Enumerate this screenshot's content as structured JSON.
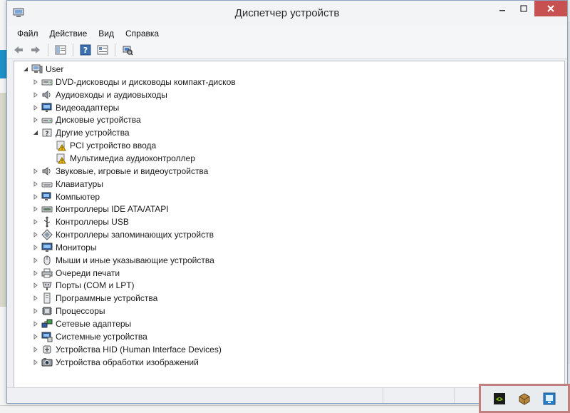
{
  "window": {
    "title": "Диспетчер устройств"
  },
  "menu": [
    "Файл",
    "Действие",
    "Вид",
    "Справка"
  ],
  "tree": {
    "root": "User",
    "items": [
      {
        "label": "DVD-дисководы и дисководы компакт-дисков",
        "icon": "dvd-drive-icon",
        "expanded": false,
        "level": 1
      },
      {
        "label": "Аудиовходы и аудиовыходы",
        "icon": "speaker-icon",
        "expanded": false,
        "level": 1
      },
      {
        "label": "Видеоадаптеры",
        "icon": "display-adapter-icon",
        "expanded": false,
        "level": 1
      },
      {
        "label": "Дисковые устройства",
        "icon": "disk-drive-icon",
        "expanded": false,
        "level": 1
      },
      {
        "label": "Другие устройства",
        "icon": "unknown-device-icon",
        "expanded": true,
        "level": 1
      },
      {
        "label": "PCI устройство ввода",
        "icon": "warning-device-icon",
        "level": 2
      },
      {
        "label": "Мультимедиа аудиоконтроллер",
        "icon": "warning-device-icon",
        "level": 2
      },
      {
        "label": "Звуковые, игровые и видеоустройства",
        "icon": "speaker-icon",
        "expanded": false,
        "level": 1
      },
      {
        "label": "Клавиатуры",
        "icon": "keyboard-icon",
        "expanded": false,
        "level": 1
      },
      {
        "label": "Компьютер",
        "icon": "computer-icon",
        "expanded": false,
        "level": 1
      },
      {
        "label": "Контроллеры IDE ATA/ATAPI",
        "icon": "ide-controller-icon",
        "expanded": false,
        "level": 1
      },
      {
        "label": "Контроллеры USB",
        "icon": "usb-icon",
        "expanded": false,
        "level": 1
      },
      {
        "label": "Контроллеры запоминающих устройств",
        "icon": "storage-controller-icon",
        "expanded": false,
        "level": 1
      },
      {
        "label": "Мониторы",
        "icon": "monitor-icon",
        "expanded": false,
        "level": 1
      },
      {
        "label": "Мыши и иные указывающие устройства",
        "icon": "mouse-icon",
        "expanded": false,
        "level": 1
      },
      {
        "label": "Очереди печати",
        "icon": "printer-icon",
        "expanded": false,
        "level": 1
      },
      {
        "label": "Порты (COM и LPT)",
        "icon": "port-icon",
        "expanded": false,
        "level": 1
      },
      {
        "label": "Программные устройства",
        "icon": "software-device-icon",
        "expanded": false,
        "level": 1
      },
      {
        "label": "Процессоры",
        "icon": "processor-icon",
        "expanded": false,
        "level": 1
      },
      {
        "label": "Сетевые адаптеры",
        "icon": "network-adapter-icon",
        "expanded": false,
        "level": 1
      },
      {
        "label": "Системные устройства",
        "icon": "system-device-icon",
        "expanded": false,
        "level": 1
      },
      {
        "label": "Устройства HID (Human Interface Devices)",
        "icon": "hid-icon",
        "expanded": false,
        "level": 1
      },
      {
        "label": "Устройства обработки изображений",
        "icon": "imaging-device-icon",
        "expanded": false,
        "level": 1
      }
    ]
  },
  "toolbar": [
    "back-arrow-icon",
    "forward-arrow-icon",
    "show-hide-console-tree-icon",
    "help-icon",
    "properties-icon",
    "scan-hardware-icon"
  ],
  "tray": [
    "nvidia-icon",
    "package-icon",
    "screen-icon"
  ],
  "colors": {
    "accent": "#1e90c8",
    "tray_highlight": "#c08080",
    "warning": "#f2c200"
  }
}
